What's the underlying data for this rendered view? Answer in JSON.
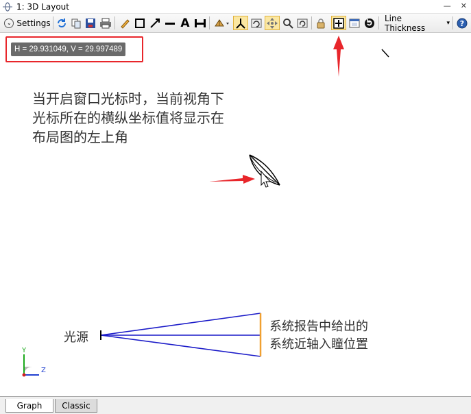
{
  "window": {
    "title": "1: 3D Layout",
    "icon": "lens-icon"
  },
  "toolbar": {
    "settings_label": "Settings",
    "line_thickness_label": "Line Thickness",
    "dropdown_glyph": "▾",
    "icons": [
      "refresh-icon",
      "copy-icon",
      "save-icon",
      "print-icon",
      "pencil-icon",
      "rectangle-icon",
      "arrow-icon",
      "line-icon",
      "text-icon",
      "dimension-icon",
      "rotate-icon",
      "axes-icon",
      "reset-view-icon",
      "pan-icon",
      "zoom-icon",
      "zoom-reset-icon",
      "lock-icon",
      "cursor-coordinates-icon",
      "window-icon",
      "refresh-circle-icon",
      "help-icon"
    ]
  },
  "canvas": {
    "coordinate_readout": "H = 29.931049, V = 29.997489",
    "annotation_text": "当开启窗口光标时，当前视角下\n光标所在的横纵坐标值将显示在\n布局图的左上角",
    "source_label": "光源",
    "pupil_label": "系统报告中给出的\n系统近轴入瞳位置",
    "axis_y": "Y",
    "axis_z": "Z"
  },
  "colors": {
    "highlight": "#e8262b",
    "rays": "#1a1ac8",
    "pupil": "#f0a030",
    "readout_bg": "#6a6a6a",
    "axis_y": "#1aa81a",
    "axis_z": "#2040d0"
  },
  "tabs": [
    {
      "label": "Graph",
      "active": true
    },
    {
      "label": "Classic",
      "active": false
    }
  ]
}
